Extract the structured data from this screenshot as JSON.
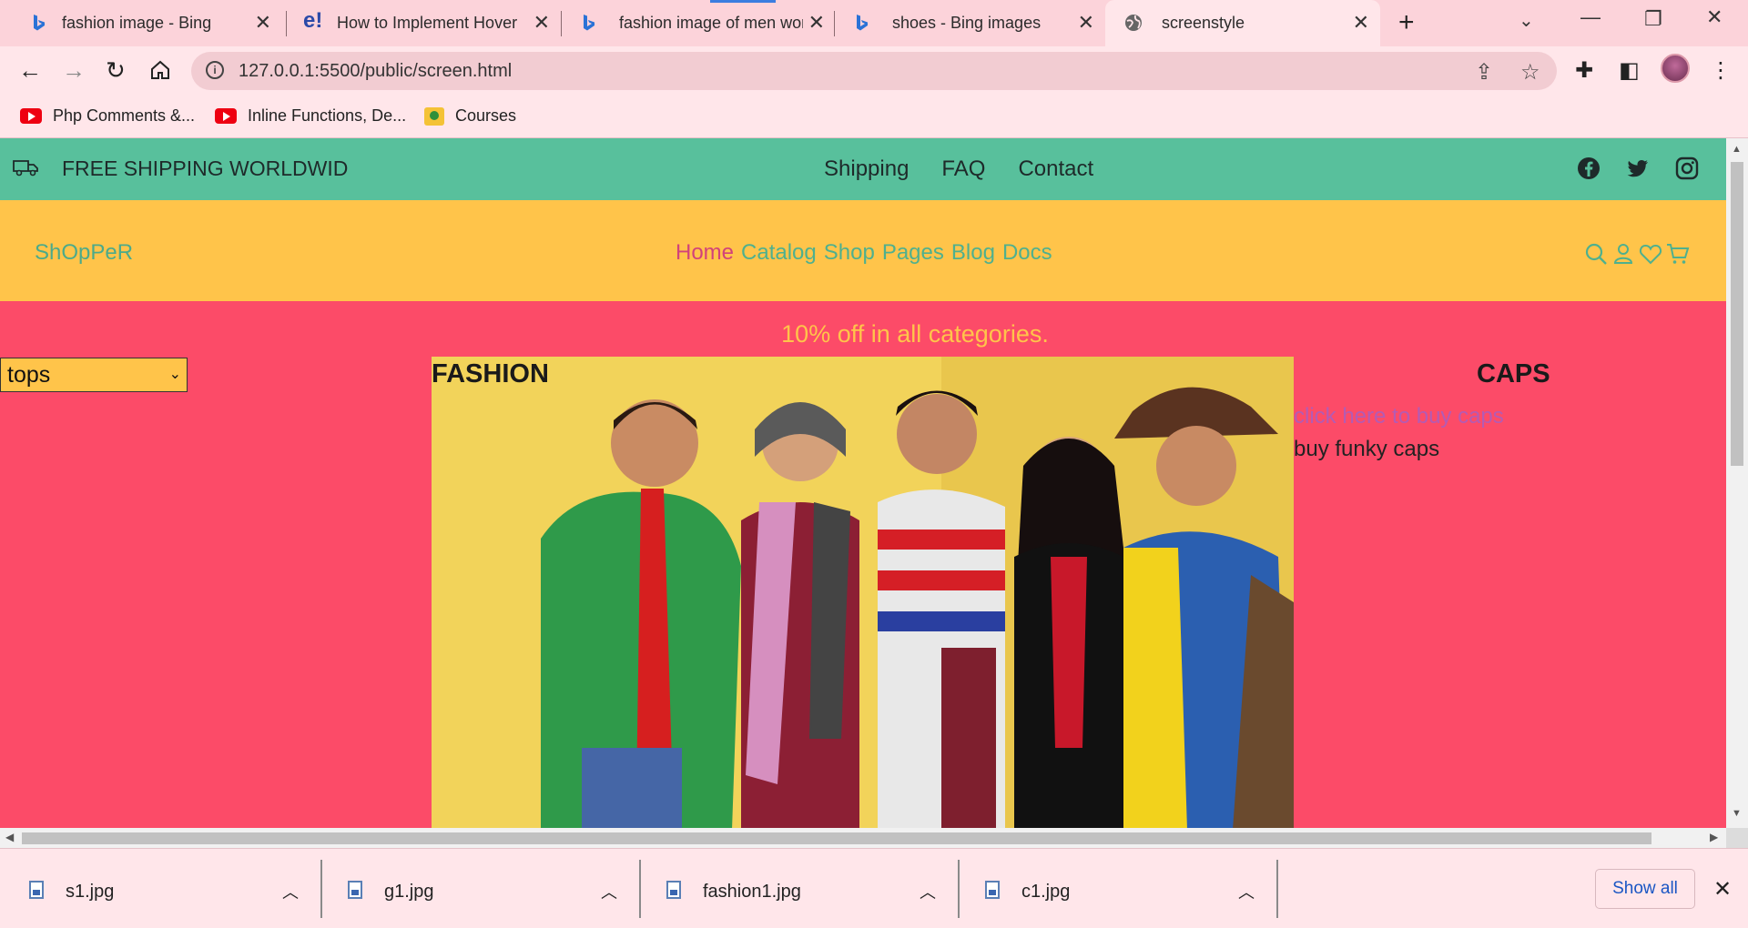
{
  "browser": {
    "tabs": [
      {
        "title": "fashion image - Bing images",
        "icon": "bing-icon"
      },
      {
        "title": "How to Implement Hover Effects",
        "icon": "educba-icon"
      },
      {
        "title": "fashion image of men women",
        "icon": "bing-icon"
      },
      {
        "title": "shoes - Bing images",
        "icon": "bing-icon"
      },
      {
        "title": "screenstyle",
        "icon": "globe-icon",
        "active": true
      }
    ],
    "address": "127.0.0.1:5500/public/screen.html",
    "bookmarks": [
      {
        "label": "Php Comments &...",
        "icon": "youtube-icon"
      },
      {
        "label": "Inline Functions, De...",
        "icon": "youtube-icon"
      },
      {
        "label": "Courses",
        "icon": "classroom-icon"
      }
    ]
  },
  "page": {
    "topbar": {
      "shipping_text": "FREE SHIPPING WORLDWID",
      "links": [
        "Shipping",
        "FAQ",
        "Contact"
      ],
      "social_icons": [
        "facebook-icon",
        "twitter-icon",
        "instagram-icon"
      ]
    },
    "header": {
      "brand": "ShOpPeR",
      "menu": [
        "Home",
        "Catalog",
        "Shop",
        "Pages",
        "Blog",
        "Docs"
      ],
      "icons": [
        "search-icon",
        "user-icon",
        "heart-icon",
        "cart-icon"
      ]
    },
    "promo": "10% off in all categories.",
    "category_select": {
      "selected": "tops"
    },
    "fashion": {
      "title": "FASHION"
    },
    "caps": {
      "title": "CAPS",
      "link": "click here to buy caps",
      "description": "buy funky caps"
    }
  },
  "downloads": {
    "files": [
      "s1.jpg",
      "g1.jpg",
      "fashion1.jpg",
      "c1.jpg"
    ],
    "show_all": "Show all"
  },
  "colors": {
    "topbar": "#58c09c",
    "header": "#ffc44a",
    "page_bg": "#fc4b68",
    "brand_text": "#4caa8a",
    "home_link": "#d2427a",
    "caps_link": "#b45bb4",
    "promo_text": "#ffc44a"
  }
}
